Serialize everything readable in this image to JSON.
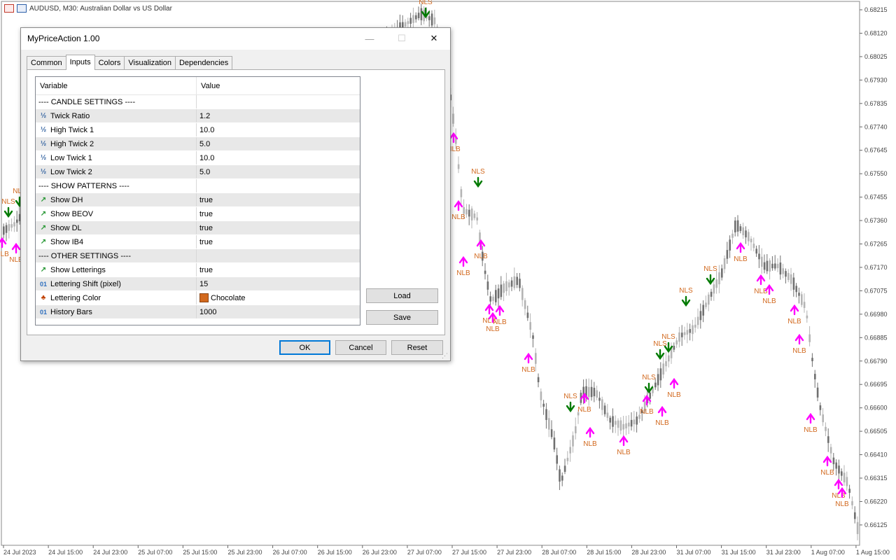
{
  "chart": {
    "symbol_title": "AUDUSD, M30:  Australian Dollar vs US Dollar",
    "price_labels": [
      "0.68215",
      "0.68120",
      "0.68025",
      "0.67930",
      "0.67835",
      "0.67740",
      "0.67645",
      "0.67550",
      "0.67455",
      "0.67360",
      "0.67265",
      "0.67170",
      "0.67075",
      "0.66980",
      "0.66885",
      "0.66790",
      "0.66695",
      "0.66600",
      "0.66505",
      "0.66410",
      "0.66315",
      "0.66220",
      "0.66125"
    ],
    "time_labels": [
      "24 Jul 2023",
      "24 Jul 15:00",
      "24 Jul 23:00",
      "25 Jul 07:00",
      "25 Jul 15:00",
      "25 Jul 23:00",
      "26 Jul 07:00",
      "26 Jul 15:00",
      "26 Jul 23:00",
      "27 Jul 07:00",
      "27 Jul 15:00",
      "27 Jul 23:00",
      "28 Jul 07:00",
      "28 Jul 15:00",
      "28 Jul 23:00",
      "31 Jul 07:00",
      "31 Jul 15:00",
      "31 Jul 23:00",
      "1 Aug 07:00",
      "1 Aug 15:00"
    ],
    "marker_sell_label": "NLS",
    "marker_buy_label": "NLB",
    "colors": {
      "sell_arrow": "#007a00",
      "buy_arrow": "#ff00ff",
      "lettering": "#d2691e",
      "bull_candle": "#b4b4b4",
      "bear_candle": "#707070"
    }
  },
  "dialog": {
    "title": "MyPriceAction 1.00",
    "tabs": [
      {
        "label": "Common"
      },
      {
        "label": "Inputs"
      },
      {
        "label": "Colors"
      },
      {
        "label": "Visualization"
      },
      {
        "label": "Dependencies"
      }
    ],
    "grid_headers": {
      "variable": "Variable",
      "value": "Value"
    },
    "rows": [
      {
        "icon": "",
        "variable": "---- CANDLE SETTINGS ----",
        "value": ""
      },
      {
        "icon": "½",
        "variable": "Twick Ratio",
        "value": "1.2"
      },
      {
        "icon": "½",
        "variable": "High Twick 1",
        "value": "10.0"
      },
      {
        "icon": "½",
        "variable": "High Twick 2",
        "value": "5.0"
      },
      {
        "icon": "½",
        "variable": "Low Twick 1",
        "value": "10.0"
      },
      {
        "icon": "½",
        "variable": "Low Twick 2",
        "value": "5.0"
      },
      {
        "icon": "",
        "variable": "---- SHOW PATTERNS ----",
        "value": ""
      },
      {
        "icon": "↗",
        "variable": "Show DH",
        "value": "true"
      },
      {
        "icon": "↗",
        "variable": "Show BEOV",
        "value": "true"
      },
      {
        "icon": "↗",
        "variable": "Show DL",
        "value": "true"
      },
      {
        "icon": "↗",
        "variable": "Show IB4",
        "value": "true"
      },
      {
        "icon": "",
        "variable": "---- OTHER SETTINGS ----",
        "value": ""
      },
      {
        "icon": "↗",
        "variable": "Show Letterings",
        "value": "true"
      },
      {
        "icon": "01",
        "variable": "Lettering Shift (pixel)",
        "value": "15"
      },
      {
        "icon": "♣",
        "variable": "Lettering Color",
        "value": "Chocolate",
        "swatch": "#d2691e"
      },
      {
        "icon": "01",
        "variable": "History Bars",
        "value": "1000"
      }
    ],
    "buttons": {
      "load": "Load",
      "save": "Save",
      "ok": "OK",
      "cancel": "Cancel",
      "reset": "Reset"
    },
    "window_controls": {
      "minimize": "—",
      "maximize": "☐",
      "close": "✕"
    }
  }
}
